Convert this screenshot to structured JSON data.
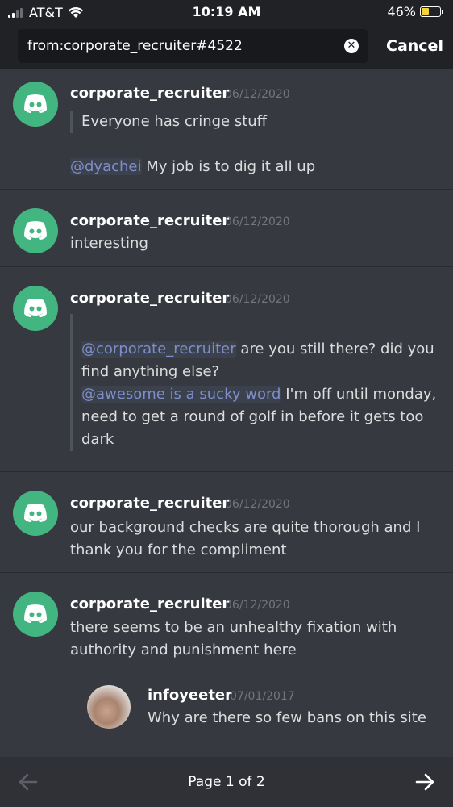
{
  "status_bar": {
    "carrier": "AT&T",
    "time": "10:19 AM",
    "battery_percent": "46%",
    "battery_level": 0.46
  },
  "search": {
    "query": "from:corporate_recruiter#4522",
    "cancel_label": "Cancel"
  },
  "results": [
    {
      "author": "corporate_recruiter",
      "timestamp": "06/12/2020",
      "quote": "Everyone has cringe stuff",
      "mention": "@dyachei",
      "text": "My job is to dig it all up"
    },
    {
      "author": "corporate_recruiter",
      "timestamp": "06/12/2020",
      "text": "interesting"
    },
    {
      "author": "corporate_recruiter",
      "timestamp": "06/12/2020",
      "quote_mention_1": "@corporate_recruiter",
      "quote_text_1a": "are you still there? did you",
      "quote_text_1b": "find anything else?",
      "quote_mention_2": "@awesome is a sucky word",
      "quote_text_2a": "I'm off until monday,",
      "quote_text_2b": "need to get a round of golf in before it gets too",
      "quote_text_2c": "dark"
    },
    {
      "author": "corporate_recruiter",
      "timestamp": "06/12/2020",
      "text_line_1": "our background checks are quite thorough and I",
      "text_line_2": "thank you for the compliment"
    },
    {
      "author": "corporate_recruiter",
      "timestamp": "06/12/2020",
      "text_line_1": "there seems to be an unhealthy fixation with",
      "text_line_2": "authority and punishment here",
      "embed": {
        "author": "infoyeeter",
        "timestamp": "07/01/2017",
        "text": "Why are there so few bans on this site"
      }
    }
  ],
  "pager": {
    "label": "Page 1 of 2",
    "prev_icon": "arrow-left-icon",
    "next_icon": "arrow-right-icon"
  },
  "colors": {
    "background": "#36393f",
    "header": "#202225",
    "avatar": "#43b581",
    "mention": "#7f8ec9"
  }
}
